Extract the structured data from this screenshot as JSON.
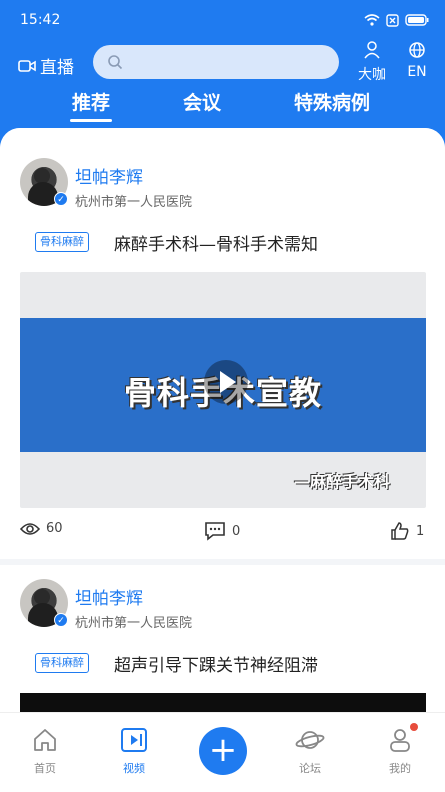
{
  "status_bar": {
    "time": "15:42"
  },
  "header": {
    "live_label": "直播",
    "search": {
      "placeholder": ""
    },
    "coffee_label": "大咖",
    "lang_label": "EN",
    "tabs": [
      {
        "label": "推荐",
        "active": true
      },
      {
        "label": "会议",
        "active": false
      },
      {
        "label": "特殊病例",
        "active": false
      }
    ]
  },
  "posts": [
    {
      "author": "坦帕李辉",
      "hospital": "杭州市第一人民医院",
      "tag": "骨科麻醉",
      "title": "麻醉手术科—骨科手术需知",
      "video_title": "骨科手术宣教",
      "video_subtitle": "—麻醉手术科",
      "views": "60",
      "comments": "0",
      "likes": "1"
    },
    {
      "author": "坦帕李辉",
      "hospital": "杭州市第一人民医院",
      "tag": "骨科麻醉",
      "title": "超声引导下踝关节神经阻滞"
    }
  ],
  "bottom_nav": [
    {
      "label": "首页",
      "icon": "home-icon",
      "active": false
    },
    {
      "label": "视频",
      "icon": "video-icon",
      "active": true
    },
    {
      "label": "",
      "icon": "plus-icon",
      "active": false
    },
    {
      "label": "论坛",
      "icon": "planet-icon",
      "active": false
    },
    {
      "label": "我的",
      "icon": "user-icon",
      "active": false
    }
  ],
  "colors": {
    "primary": "#1f7bf0",
    "badge": "#e74c3c"
  }
}
